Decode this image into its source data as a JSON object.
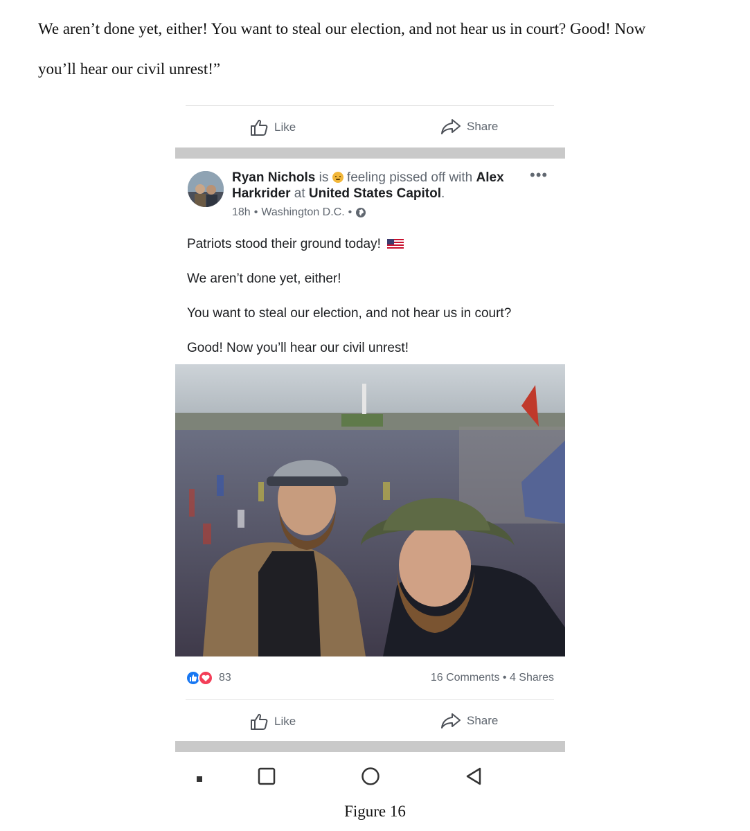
{
  "document": {
    "line1": "We aren’t done yet, either! You want to steal our election, and not hear us in court? Good! Now",
    "line2": "you’ll hear our civil unrest!”",
    "caption": "Figure 16"
  },
  "top_actions": {
    "like_label": "Like",
    "share_label": "Share"
  },
  "post": {
    "author": "Ryan Nichols",
    "is_text": " is ",
    "feeling_text": " feeling pissed off with ",
    "tagged": "Alex Harkrider",
    "at_text": " at ",
    "location": "United States Capitol",
    "period": ".",
    "time": "18h",
    "place": "Washington D.C.",
    "more_label": "•••",
    "lines": [
      "Patriots stood their ground today!",
      "We aren’t done yet, either!",
      "You want to steal our election, and not hear us in court?",
      "Good! Now you’ll hear our civil unrest!"
    ],
    "reaction_count": "83",
    "comments": "16 Comments",
    "shares": "4 Shares",
    "like_label": "Like",
    "share_label": "Share"
  },
  "colors": {
    "facebook_blue": "#1877f2",
    "love_red": "#f33e58",
    "divider_gray": "#c9c9c9"
  },
  "icons": [
    "thumbs-up-icon",
    "share-arrow-icon",
    "globe-icon",
    "us-flag-icon",
    "angry-emoji-icon",
    "square-icon",
    "circle-icon",
    "back-triangle-icon"
  ]
}
